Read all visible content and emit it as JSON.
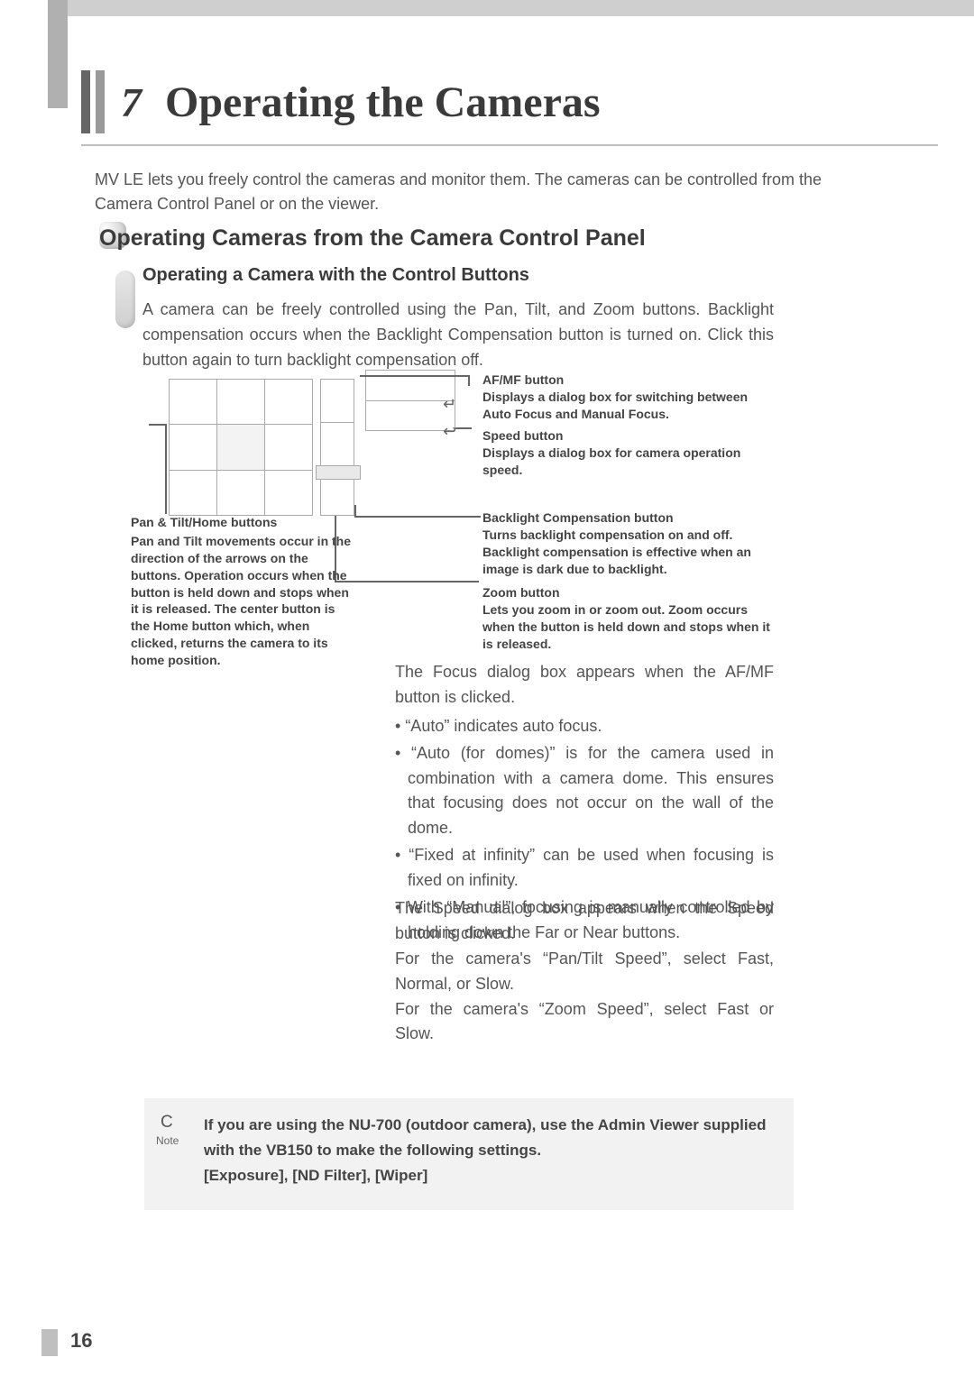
{
  "chapter": {
    "number": "7",
    "title": "Operating the Cameras"
  },
  "intro": "MV LE lets you freely control the cameras and monitor them. The cameras can be controlled from the Camera Control Panel or on the viewer.",
  "section_heading": "Operating Cameras from the Camera Control Panel",
  "subsection": {
    "heading": "Operating a Camera with the Control Buttons",
    "body": "A camera can be freely controlled using the Pan, Tilt, and Zoom buttons. Backlight compensation occurs when the Backlight Compensation button is turned on. Click this button again to turn backlight compensation off."
  },
  "diagram": {
    "left": {
      "title": "Pan & Tilt/Home buttons",
      "body": "Pan and Tilt movements occur in the direction of the arrows on the buttons. Operation occurs when the button is held down and stops when it is released. The center button is the Home button which, when clicked, returns the camera to its home position."
    },
    "right": [
      {
        "title": "AF/MF button",
        "body": "Displays a dialog box for switching between Auto Focus and Manual Focus."
      },
      {
        "title": "Speed button",
        "body": "Displays a dialog box for camera operation speed."
      },
      {
        "title": "Backlight Compensation button",
        "body": "Turns backlight compensation on and off. Backlight compensation is effective when an image is dark due to backlight."
      },
      {
        "title": "Zoom button",
        "body": "Lets you zoom in or zoom out. Zoom occurs when the button is held down and stops when it is released."
      }
    ]
  },
  "focus_dialog": {
    "intro": "The Focus dialog box appears when the AF/MF button is clicked.",
    "bullets": [
      "“Auto” indicates auto focus.",
      "“Auto (for domes)” is for the camera used in combination with a camera dome. This ensures that focusing does not occur on the wall of the dome.",
      "“Fixed at infinity” can be used when focusing is fixed on infinity.",
      "With “Manual”, focusing is manually controlled by holding down the Far or Near buttons."
    ]
  },
  "speed_dialog": {
    "lines": [
      "The Speed dialog box appears when the Speed button is clicked.",
      "For the camera's “Pan/Tilt Speed”, select Fast, Normal, or Slow.",
      "For the camera's “Zoom Speed”, select Fast or Slow."
    ]
  },
  "note": {
    "letter": "C",
    "word": "Note",
    "text": "If you are using the NU-700 (outdoor camera), use the Admin Viewer supplied with the VB150 to make the following settings.",
    "settings": "[Exposure], [ND Filter], [Wiper]"
  },
  "page_number": "16"
}
